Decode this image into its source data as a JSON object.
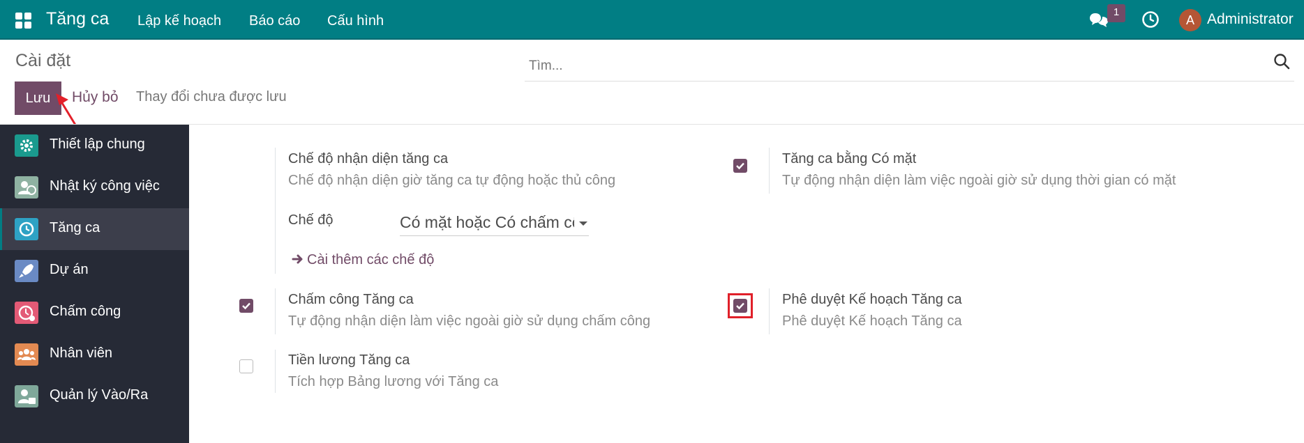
{
  "navbar": {
    "app_name": "Tăng ca",
    "menu": [
      "Lập kế hoạch",
      "Báo cáo",
      "Cấu hình"
    ],
    "messages_badge": "1",
    "user_initial": "A",
    "user_name": "Administrator",
    "bg_color": "#017e84"
  },
  "control_panel": {
    "title": "Cài đặt",
    "search_placeholder": "Tìm...",
    "save_label": "Lưu",
    "discard_label": "Hủy bỏ",
    "unsaved_text": "Thay đổi chưa được lưu"
  },
  "sidebar": {
    "items": [
      {
        "label": "Thiết lập chung",
        "icon": "gear-icon",
        "color": "#1a9a8e",
        "active": false
      },
      {
        "label": "Nhật ký công việc",
        "icon": "timesheet-icon",
        "color": "#8fb2a2",
        "active": false
      },
      {
        "label": "Tăng ca",
        "icon": "overtime-icon",
        "color": "#2ea2c4",
        "active": true
      },
      {
        "label": "Dự án",
        "icon": "rocket-icon",
        "color": "#6a8ac4",
        "active": false
      },
      {
        "label": "Chấm công",
        "icon": "attendance-icon",
        "color": "#e35a76",
        "active": false
      },
      {
        "label": "Nhân viên",
        "icon": "employees-icon",
        "color": "#e38a52",
        "active": false
      },
      {
        "label": "Quản lý Vào/Ra",
        "icon": "checkin-icon",
        "color": "#7fa89a",
        "active": false
      }
    ]
  },
  "settings": {
    "recognition_mode": {
      "title": "Chế độ nhận diện tăng ca",
      "desc": "Chế độ nhận diện giờ tăng ca tự động hoặc thủ công",
      "mode_label": "Chế độ",
      "mode_value": "Có mặt hoặc Có chấm công",
      "more_link": "Cài thêm các chế độ"
    },
    "presence_overtime": {
      "title": "Tăng ca bằng Có mặt",
      "desc": "Tự động nhận diện làm việc ngoài giờ sử dụng thời gian có mặt",
      "checked": true
    },
    "attendance_overtime": {
      "title": "Chấm công Tăng ca",
      "desc": "Tự động nhận diện làm việc ngoài giờ sử dụng chấm công",
      "checked": true
    },
    "plan_approval": {
      "title": "Phê duyệt Kế hoạch Tăng ca",
      "desc": "Phê duyệt Kế hoạch Tăng ca",
      "checked": true
    },
    "payroll": {
      "title": "Tiền lương Tăng ca",
      "desc": "Tích hợp Bảng lương với Tăng ca",
      "checked": false
    }
  }
}
